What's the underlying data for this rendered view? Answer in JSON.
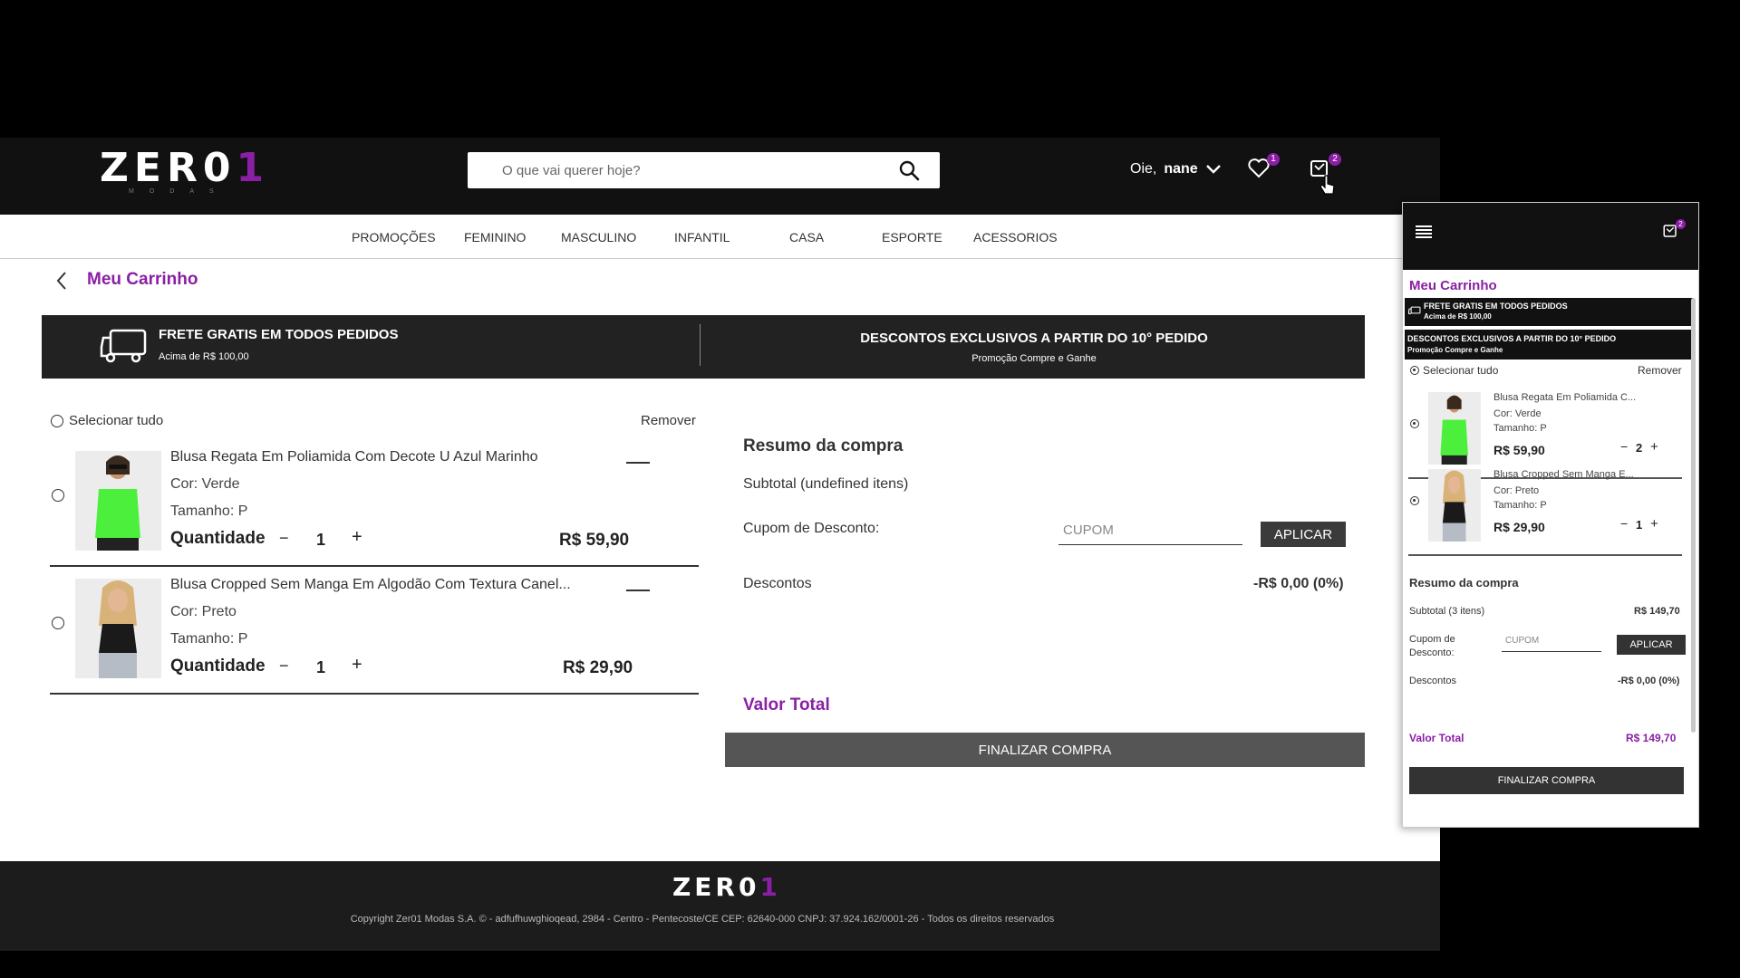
{
  "header": {
    "logo": "ZER01",
    "logo_sub": "MODAS",
    "search_placeholder": "O que vai querer hoje?",
    "greeting": "Oie,",
    "user_name": "nane",
    "wishlist_count": "1",
    "cart_count": "2"
  },
  "nav": {
    "items": [
      "PROMOÇÕES",
      "FEMININO",
      "MASCULINO",
      "INFANTIL",
      "CASA",
      "ESPORTE",
      "ACESSORIOS"
    ]
  },
  "cart": {
    "title": "Meu Carrinho",
    "select_all": "Selecionar tudo",
    "remove": "Remover"
  },
  "banner": {
    "left_title": "FRETE GRATIS EM TODOS PEDIDOS",
    "left_sub": "Acima de R$ 100,00",
    "right_title": "DESCONTOS EXCLUSIVOS A PARTIR DO 10° PEDIDO",
    "right_sub": "Promoção Compre e Ganhe"
  },
  "items": [
    {
      "name": "Blusa Regata Em Poliamida Com Decote U Azul Marinho",
      "color": "Cor: Verde",
      "size": "Tamanho: P",
      "qty_label": "Quantidade",
      "qty": "1",
      "price": "R$ 59,90",
      "garment_color": "#4cf03c"
    },
    {
      "name": "Blusa Cropped Sem Manga Em Algodão Com Textura Canel...",
      "color": "Cor: Preto",
      "size": "Tamanho: P",
      "qty_label": "Quantidade",
      "qty": "1",
      "price": "R$ 29,90",
      "garment_color": "#1a1a1a"
    }
  ],
  "summary": {
    "title": "Resumo da compra",
    "subtotal": "Subtotal (undefined itens)",
    "coupon_label": "Cupom de Desconto:",
    "coupon_placeholder": "CUPOM",
    "apply": "APLICAR",
    "discounts_label": "Descontos",
    "discounts_value": "-R$ 0,00 (0%)",
    "total_label": "Valor Total",
    "checkout": "FINALIZAR COMPRA"
  },
  "footer": {
    "logo": "ZER01",
    "copyright": "Copyright Zer01 Modas S.A. © - adfufhuwghioqead, 2984 - Centro - Pentecoste/CE CEP: 62640-000 CNPJ: 37.924.162/0001-26 - Todos os direitos reservados"
  },
  "mobile": {
    "cart_count": "2",
    "title": "Meu Carrinho",
    "banner1_title": "FRETE GRATIS EM TODOS PEDIDOS",
    "banner1_sub": "Acima de R$ 100,00",
    "banner2_title": "DESCONTOS EXCLUSIVOS A PARTIR DO 10° PEDIDO",
    "banner2_sub": "Promoção Compre e Ganhe",
    "select_all": "Selecionar tudo",
    "remove": "Remover",
    "items": [
      {
        "name": "Blusa Regata Em Poliamida C...",
        "color": "Cor: Verde",
        "size": "Tamanho: P",
        "price": "R$ 59,90",
        "qty": "2"
      },
      {
        "name": "Blusa Cropped Sem Manga E...",
        "color": "Cor: Preto",
        "size": "Tamanho: P",
        "price": "R$ 29,90",
        "qty": "1"
      }
    ],
    "summary_title": "Resumo da compra",
    "subtotal_label": "Subtotal (3 itens)",
    "subtotal_value": "R$ 149,70",
    "coupon_label": "Cupom de Desconto:",
    "coupon_placeholder": "CUPOM",
    "apply": "APLICAR",
    "discounts_label": "Descontos",
    "discounts_value": "-R$ 0,00 (0%)",
    "total_label": "Valor Total",
    "total_value": "R$ 149,70",
    "checkout": "FINALIZAR COMPRA"
  },
  "colors": {
    "accent": "#8a1fa5",
    "header_bg": "#111111",
    "banner_bg": "#222222",
    "button_dark": "#3b3b3b",
    "checkout_bg": "#555555"
  }
}
